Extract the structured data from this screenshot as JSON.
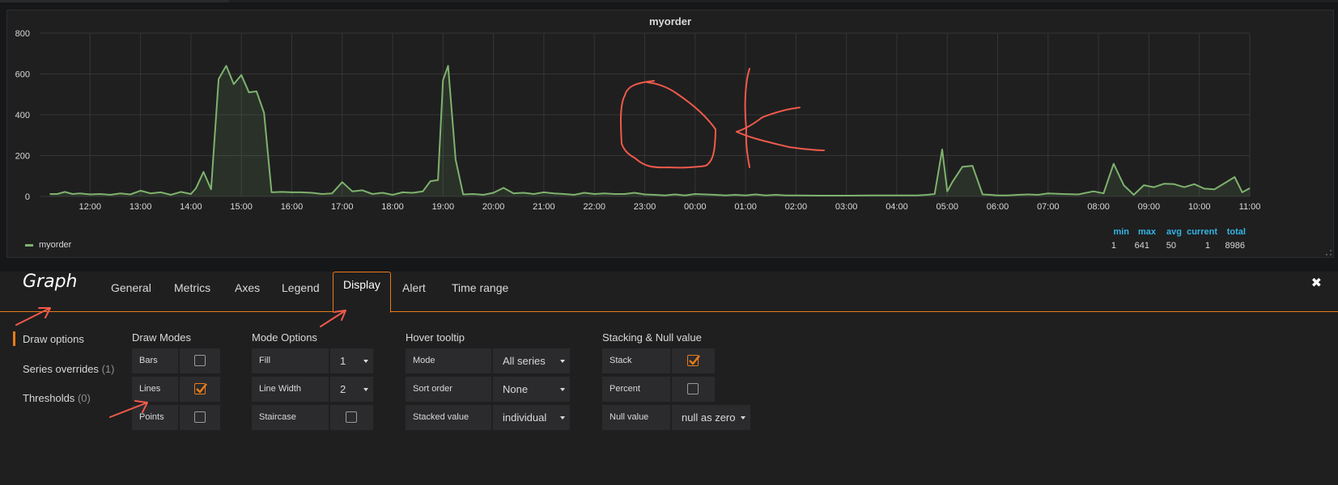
{
  "panel": {
    "title": "myorder",
    "legend": {
      "series_name": "myorder",
      "series_color": "#7eb26d"
    },
    "stats": {
      "headers": [
        "min",
        "max",
        "avg",
        "current",
        "total"
      ],
      "values": [
        "1",
        "641",
        "50",
        "1",
        "8986"
      ]
    }
  },
  "chart_data": {
    "type": "line",
    "title": "myorder",
    "ylim": [
      0,
      800
    ],
    "yticks": [
      0,
      200,
      400,
      600,
      800
    ],
    "x_tick_labels": [
      "12:00",
      "13:00",
      "14:00",
      "15:00",
      "16:00",
      "17:00",
      "18:00",
      "19:00",
      "20:00",
      "21:00",
      "22:00",
      "23:00",
      "00:00",
      "01:00",
      "02:00",
      "03:00",
      "04:00",
      "05:00",
      "06:00",
      "07:00",
      "08:00",
      "09:00",
      "10:00",
      "11:00"
    ],
    "grid": true,
    "legend": "bottom-left",
    "series": [
      {
        "name": "myorder",
        "color": "#7eb26d",
        "fill": true,
        "x_hours": [
          11.2,
          11.35,
          11.5,
          11.65,
          11.8,
          12.0,
          12.2,
          12.4,
          12.6,
          12.8,
          13.0,
          13.2,
          13.4,
          13.6,
          13.8,
          14.0,
          14.1,
          14.25,
          14.4,
          14.55,
          14.7,
          14.85,
          15.0,
          15.15,
          15.3,
          15.45,
          15.6,
          15.8,
          16.0,
          16.2,
          16.4,
          16.6,
          16.8,
          17.0,
          17.2,
          17.4,
          17.6,
          17.8,
          18.0,
          18.2,
          18.4,
          18.6,
          18.75,
          18.9,
          19.0,
          19.1,
          19.25,
          19.4,
          19.6,
          19.8,
          20.0,
          20.2,
          20.4,
          20.6,
          20.8,
          21.0,
          21.2,
          21.4,
          21.6,
          21.8,
          22.0,
          22.2,
          22.4,
          22.6,
          22.8,
          23.0,
          23.2,
          23.4,
          23.6,
          23.8,
          24.0,
          24.2,
          24.4,
          24.6,
          24.8,
          25.0,
          25.2,
          25.4,
          25.6,
          25.8,
          26.0,
          26.5,
          27.0,
          27.5,
          28.0,
          28.2,
          28.4,
          28.6,
          28.75,
          28.9,
          29.0,
          29.1,
          29.3,
          29.5,
          29.7,
          29.85,
          30.0,
          30.2,
          30.4,
          30.6,
          30.8,
          31.0,
          31.3,
          31.6,
          31.9,
          32.1,
          32.3,
          32.5,
          32.7,
          32.9,
          33.1,
          33.3,
          33.5,
          33.7,
          33.9,
          34.1,
          34.3,
          34.5,
          34.7,
          34.85,
          35.0
        ],
        "values": [
          12,
          12,
          22,
          12,
          15,
          10,
          12,
          8,
          15,
          10,
          28,
          15,
          20,
          8,
          22,
          12,
          40,
          120,
          35,
          575,
          640,
          550,
          595,
          510,
          515,
          410,
          20,
          22,
          20,
          20,
          18,
          12,
          15,
          70,
          25,
          30,
          12,
          18,
          8,
          20,
          18,
          25,
          75,
          80,
          570,
          640,
          180,
          10,
          12,
          8,
          18,
          42,
          15,
          18,
          12,
          20,
          15,
          12,
          8,
          18,
          12,
          15,
          12,
          12,
          18,
          10,
          8,
          5,
          10,
          5,
          12,
          10,
          8,
          5,
          8,
          5,
          10,
          5,
          8,
          5,
          5,
          4,
          4,
          5,
          5,
          5,
          5,
          8,
          12,
          230,
          25,
          70,
          145,
          150,
          10,
          8,
          5,
          5,
          8,
          10,
          8,
          15,
          12,
          10,
          25,
          15,
          160,
          55,
          8,
          55,
          45,
          62,
          60,
          45,
          60,
          38,
          35,
          65,
          95,
          20,
          40,
          5
        ]
      }
    ]
  },
  "editor": {
    "title": "Graph",
    "tabs": [
      "General",
      "Metrics",
      "Axes",
      "Legend",
      "Display",
      "Alert",
      "Time range"
    ],
    "active_tab": "Display",
    "close_symbol": "✖",
    "sidenav": [
      {
        "label": "Draw options",
        "count": ""
      },
      {
        "label": "Series overrides",
        "count": "(1)"
      },
      {
        "label": "Thresholds",
        "count": "(0)"
      }
    ],
    "draw_modes": {
      "title": "Draw Modes",
      "bars_label": "Bars",
      "bars_checked": false,
      "lines_label": "Lines",
      "lines_checked": true,
      "points_label": "Points",
      "points_checked": false
    },
    "mode_options": {
      "title": "Mode Options",
      "fill_label": "Fill",
      "fill_value": "1",
      "line_width_label": "Line Width",
      "line_width_value": "2",
      "staircase_label": "Staircase",
      "staircase_checked": false
    },
    "hover_tooltip": {
      "title": "Hover tooltip",
      "mode_label": "Mode",
      "mode_value": "All series",
      "sort_label": "Sort order",
      "sort_value": "None",
      "stacked_label": "Stacked value",
      "stacked_value": "individual"
    },
    "stacking": {
      "title": "Stacking & Null value",
      "stack_label": "Stack",
      "stack_checked": true,
      "percent_label": "Percent",
      "percent_checked": false,
      "null_label": "Null value",
      "null_value": "null as zero"
    }
  },
  "colors": {
    "accent": "#eb7b18",
    "annotation": "#f05a4a",
    "stat_header": "#33b5e5"
  }
}
